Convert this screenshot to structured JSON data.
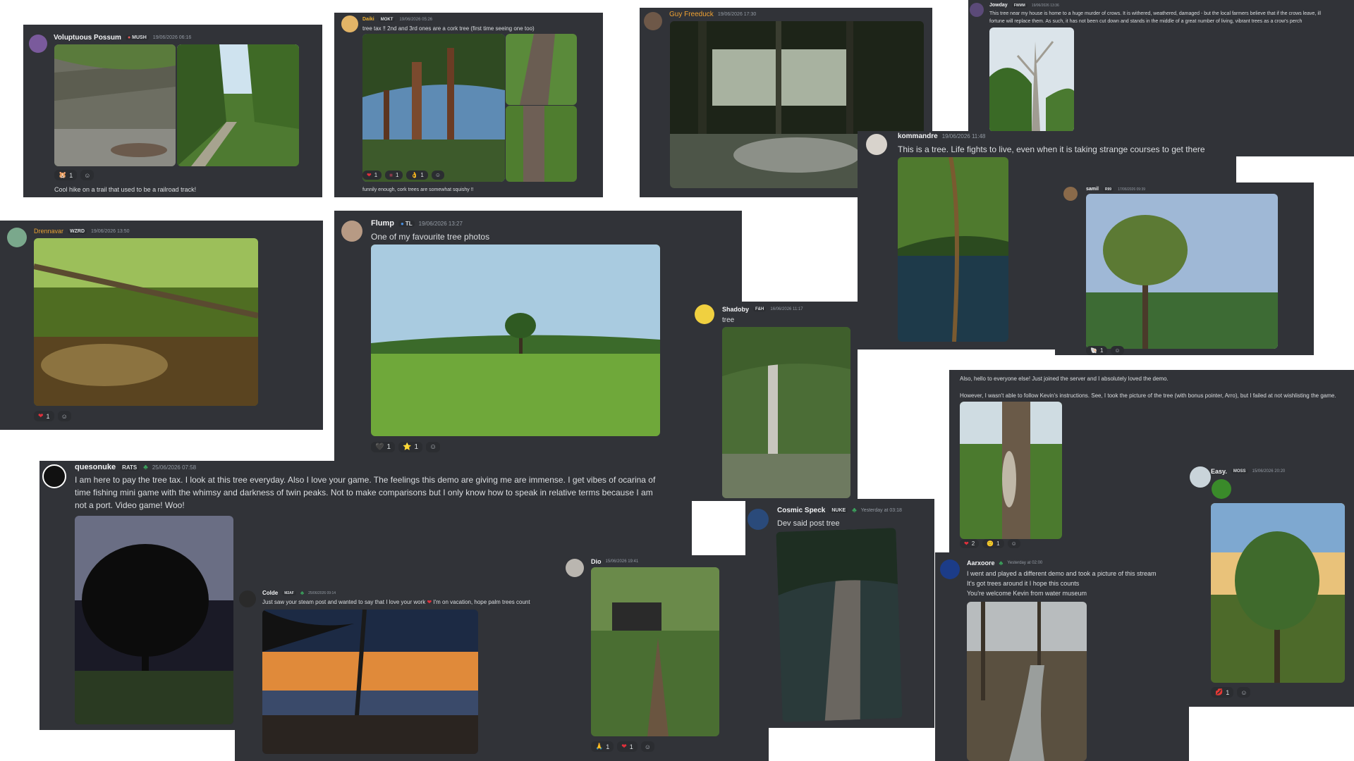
{
  "posts": {
    "possum": {
      "name": "Voluptuous Possum",
      "tag": "MUSH",
      "ts": "19/06/2026 06:16",
      "caption": "Cool hike on a trail that used to be a railroad track!",
      "reactions": [
        {
          "emoji": "🐹",
          "count": "1"
        }
      ]
    },
    "daiki": {
      "name": "Daiki",
      "tag": "MOKT",
      "ts": "19/06/2026 05:26",
      "text": "tree tax ‼ 2nd and 3rd ones are a cork tree (first time seeing one too)",
      "caption": "funnily enough, cork trees are somewhat squishy ‼",
      "reactions": [
        {
          "emoji": "❤",
          "count": "1"
        },
        {
          "emoji": "■",
          "count": "1"
        },
        {
          "emoji": "👌",
          "count": "1"
        }
      ]
    },
    "guy": {
      "name": "Guy Freeduck",
      "ts": "19/06/2026 17:30"
    },
    "jowday": {
      "name": "Jowday",
      "tag": "FWMM",
      "ts": "19/06/2026 13:36",
      "text1": "This tree near my house is home to a huge murder of crows. It is withered, weathered, damaged - but the local farmers believe that if the crows leave, ill",
      "text2": "fortune will replace them. As such, it has not been cut down and stands in the middle of a great number of living, vibrant trees as a crow's perch"
    },
    "kommandre": {
      "name": "kommandre",
      "ts": "19/06/2026 11:48",
      "text": "This is a tree. Life fights to live, even when it is taking strange courses to get there"
    },
    "samil": {
      "name": "samil",
      "tag": "R99",
      "ts": "17/06/2026 09:39",
      "reactions": [
        {
          "emoji": "🐚",
          "count": "1"
        }
      ]
    },
    "drennavar": {
      "name": "Drennavar",
      "tag": "WZRD",
      "ts": "19/06/2026 13:50",
      "reactions": [
        {
          "emoji": "❤",
          "count": "1"
        }
      ]
    },
    "flump": {
      "name": "Flump",
      "tag": "TL",
      "ts": "19/06/2026 13:27",
      "text": "One of my favourite tree photos",
      "reactions": [
        {
          "emoji": "🖤",
          "count": "1"
        },
        {
          "emoji": "⭐",
          "count": "1"
        }
      ]
    },
    "shadoby": {
      "name": "Shadoby",
      "tag": "F&H",
      "ts": "16/06/2026 11:17",
      "text": "tree"
    },
    "arro": {
      "text1": "Also, hello to everyone else! Just joined the server and I absolutely loved the demo.",
      "text2": "However, I wasn't able to follow Kevin's instructions. See, I took the picture of the tree (with bonus pointer, Arro), but I failed at not wishlisting the game.",
      "reactions": [
        {
          "emoji": "❤",
          "count": "2"
        },
        {
          "emoji": "🙂",
          "count": "1"
        }
      ]
    },
    "easy": {
      "name": "Easy.",
      "tag": "MOSS",
      "ts": "15/06/2026 20:20",
      "reactions": [
        {
          "emoji": "💋",
          "count": "1"
        }
      ]
    },
    "queso": {
      "name": "quesonuke",
      "tag": "RATS",
      "ts": "25/06/2026 07:58",
      "line1": "I am here to pay the tree tax. I look at this tree everyday. Also I love your game. The feelings this demo are giving me are immense. I get vibes of ocarina of",
      "line2": "time fishing mini game with the whimsy and darkness of twin peaks. Not to make comparisons but I only know how to speak in relative terms because I am",
      "line3": "not a port. Video game! Woo!"
    },
    "colde": {
      "name": "Colde",
      "tag": "M2AF",
      "ts": "25/06/2026 09:14",
      "text_a": "Just saw your steam post and wanted to say that I love your work",
      "text_b": "I'm on vacation, hope palm trees count"
    },
    "dio": {
      "name": "Dio",
      "ts": "15/06/2026 19:41",
      "reactions": [
        {
          "emoji": "🙏",
          "count": "1"
        },
        {
          "emoji": "❤",
          "count": "1"
        }
      ]
    },
    "cosmic": {
      "name": "Cosmic Speck",
      "tag": "NUKE",
      "ts": "Yesterday at 03:18",
      "text": "Dev said post tree"
    },
    "aarxoore": {
      "name": "Aarxoore",
      "ts": "Yesterday at 02:00",
      "line1": "I went and played a different demo and took a picture of this stream",
      "line2": "It's got trees around it I hope this counts",
      "line3": "You're welcome Kevin from water museum"
    }
  }
}
